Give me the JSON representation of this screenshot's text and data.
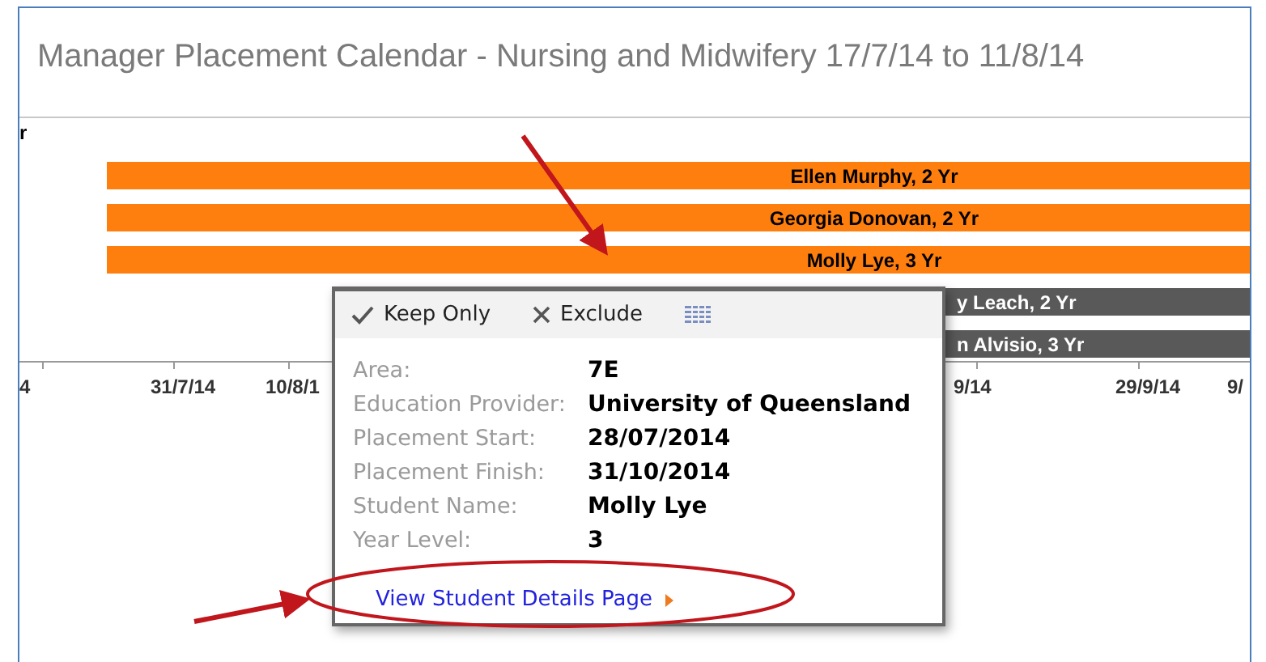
{
  "title": "Manager Placement Calendar - Nursing and Midwifery 17/7/14 to 11/8/14",
  "axis_fragment": "r",
  "bars": [
    {
      "label": "Ellen Murphy, 2 Yr",
      "kind": "highlighted"
    },
    {
      "label": "Georgia Donovan, 2 Yr",
      "kind": "highlighted"
    },
    {
      "label": "Molly Lye, 3 Yr",
      "kind": "highlighted"
    },
    {
      "label": "y Leach, 2 Yr",
      "kind": "dimmed"
    },
    {
      "label": "n Alvisio, 3 Yr",
      "kind": "dimmed"
    }
  ],
  "axis_ticks": [
    "4",
    "31/7/14",
    "10/8/1",
    "9/14",
    "29/9/14",
    "9/"
  ],
  "tooltip": {
    "actions": [
      {
        "label": "Keep Only",
        "kind": "keep"
      },
      {
        "label": "Exclude",
        "kind": "exclude"
      },
      {
        "kind": "view-data"
      }
    ],
    "fields": [
      {
        "label": "Area:",
        "value": "7E"
      },
      {
        "label": "Education Provider:",
        "value": "University of Queensland"
      },
      {
        "label": "Placement Start:",
        "value": "28/07/2014"
      },
      {
        "label": "Placement Finish:",
        "value": "31/10/2014"
      },
      {
        "label": "Student Name:",
        "value": "Molly Lye"
      },
      {
        "label": "Year Level:",
        "value": "3"
      }
    ],
    "link": "View Student Details Page"
  }
}
